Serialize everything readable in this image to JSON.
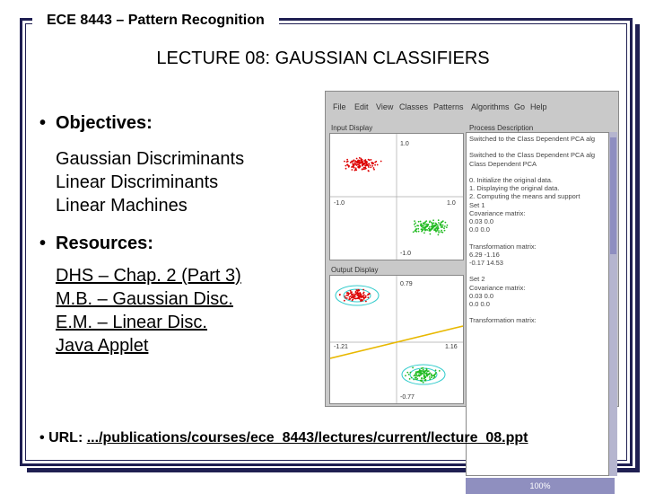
{
  "slide": {
    "header": "ECE 8443 – Pattern Recognition",
    "title": "LECTURE 08: GAUSSIAN CLASSIFIERS",
    "objectives_label": "Objectives:",
    "objectives": [
      "Gaussian Discriminants",
      "Linear Discriminants",
      "Linear Machines"
    ],
    "resources_label": "Resources:",
    "resources": [
      "DHS – Chap. 2 (Part 3)",
      "M.B. – Gaussian Disc.",
      "E.M. – Linear Disc.",
      "Java Applet"
    ],
    "url_label": "URL:",
    "url": ".../publications/courses/ece_8443/lectures/current/lecture_08.ppt",
    "bullet_char": "•"
  },
  "applet": {
    "menu": [
      "File",
      "Edit",
      "View",
      "Classes",
      "Patterns",
      "Algorithms",
      "Go",
      "Help"
    ],
    "input_label": "Input Display",
    "output_label": "Output Display",
    "process_label": "Process Description",
    "input_ticks": {
      "top": "1.0",
      "left": "-1.0",
      "right": "1.0",
      "bottom": "-1.0"
    },
    "output_ticks": {
      "top": "0.79",
      "left": "-1.21",
      "right": "1.16",
      "bottom": "-0.77"
    },
    "process_lines": [
      "Switched to the Class Dependent PCA alg",
      "",
      "Switched to the Class Dependent PCA alg",
      "Class Dependent PCA",
      "",
      "0. Initialize the original data.",
      "1. Displaying the original data.",
      "2. Computing the means and support",
      "  Set 1",
      "  Covariance matrix:",
      "     0.03    0.0",
      "     0.0     0.0",
      "",
      "  Transformation matrix:",
      "     6.29   -1.16",
      "    -0.17  14.53",
      "",
      "  Set 2",
      "  Covariance matrix:",
      "     0.03    0.0",
      "     0.0     0.0",
      "",
      "  Transformation matrix:"
    ],
    "status": "100%",
    "colors": {
      "red": "#dd0000",
      "green": "#22bb22",
      "cyan": "#33cccc",
      "yellow": "#e8b800"
    }
  }
}
